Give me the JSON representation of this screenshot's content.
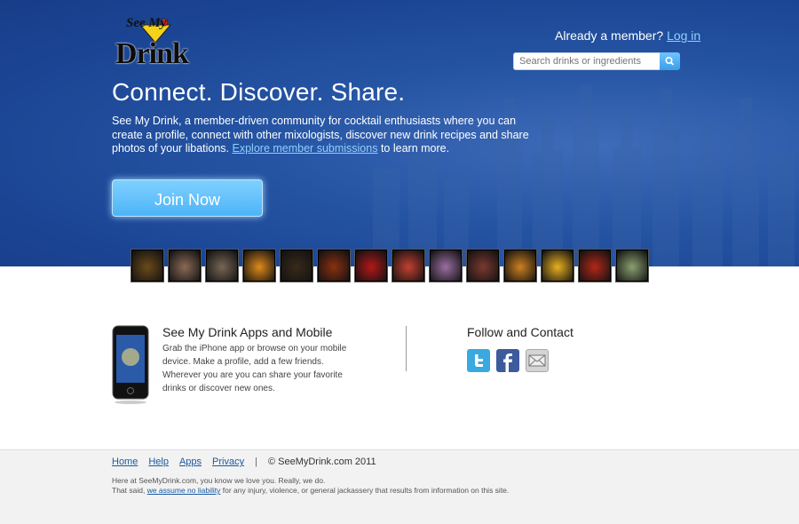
{
  "logo": {
    "see_text": "See My",
    "drink_text": "Drink"
  },
  "header": {
    "member_prompt": "Already a member?",
    "login_label": "Log in",
    "search_placeholder": "Search drinks or ingredients"
  },
  "hero": {
    "headline": "Connect. Discover. Share.",
    "intro_text": "See My Drink, a member-driven community for cocktail enthusiasts where you can create a profile, connect with other mixologists, discover new drink recipes and share photos of your libations.",
    "intro_link": "Explore member submissions",
    "intro_suffix": "to learn more.",
    "join_label": "Join Now"
  },
  "thumbnails": [
    {
      "color": "#6b4a1a"
    },
    {
      "color": "#8a6a55"
    },
    {
      "color": "#776655"
    },
    {
      "color": "#e0891a"
    },
    {
      "color": "#3a2a1a"
    },
    {
      "color": "#8a3010"
    },
    {
      "color": "#b21818"
    },
    {
      "color": "#c44030"
    },
    {
      "color": "#9a6fa0"
    },
    {
      "color": "#7a3a30"
    },
    {
      "color": "#cc8020"
    },
    {
      "color": "#e8b020"
    },
    {
      "color": "#b02818"
    },
    {
      "color": "#8aa070"
    }
  ],
  "apps": {
    "title": "See My Drink Apps and Mobile",
    "description": "Grab the iPhone app or browse on your mobile device. Make a profile, add a few friends. Wherever you are you can share your favorite drinks or discover new ones."
  },
  "follow": {
    "title": "Follow and Contact",
    "icons": [
      "twitter-icon",
      "facebook-icon",
      "mail-icon"
    ]
  },
  "footer": {
    "links": [
      "Home",
      "Help",
      "Apps",
      "Privacy"
    ],
    "separator": "|",
    "copyright": "© SeeMyDrink.com 2011",
    "legal_line1": "Here at SeeMyDrink.com, you know we love you. Really, we do.",
    "legal_prefix": "That said,",
    "legal_link": "we assume no liability",
    "legal_suffix": "for any injury, violence, or general jackassery that results from information on this site."
  },
  "colors": {
    "hero_bg": "#1f4b99",
    "accent": "#4db4f6",
    "link": "#8fd0ff"
  }
}
